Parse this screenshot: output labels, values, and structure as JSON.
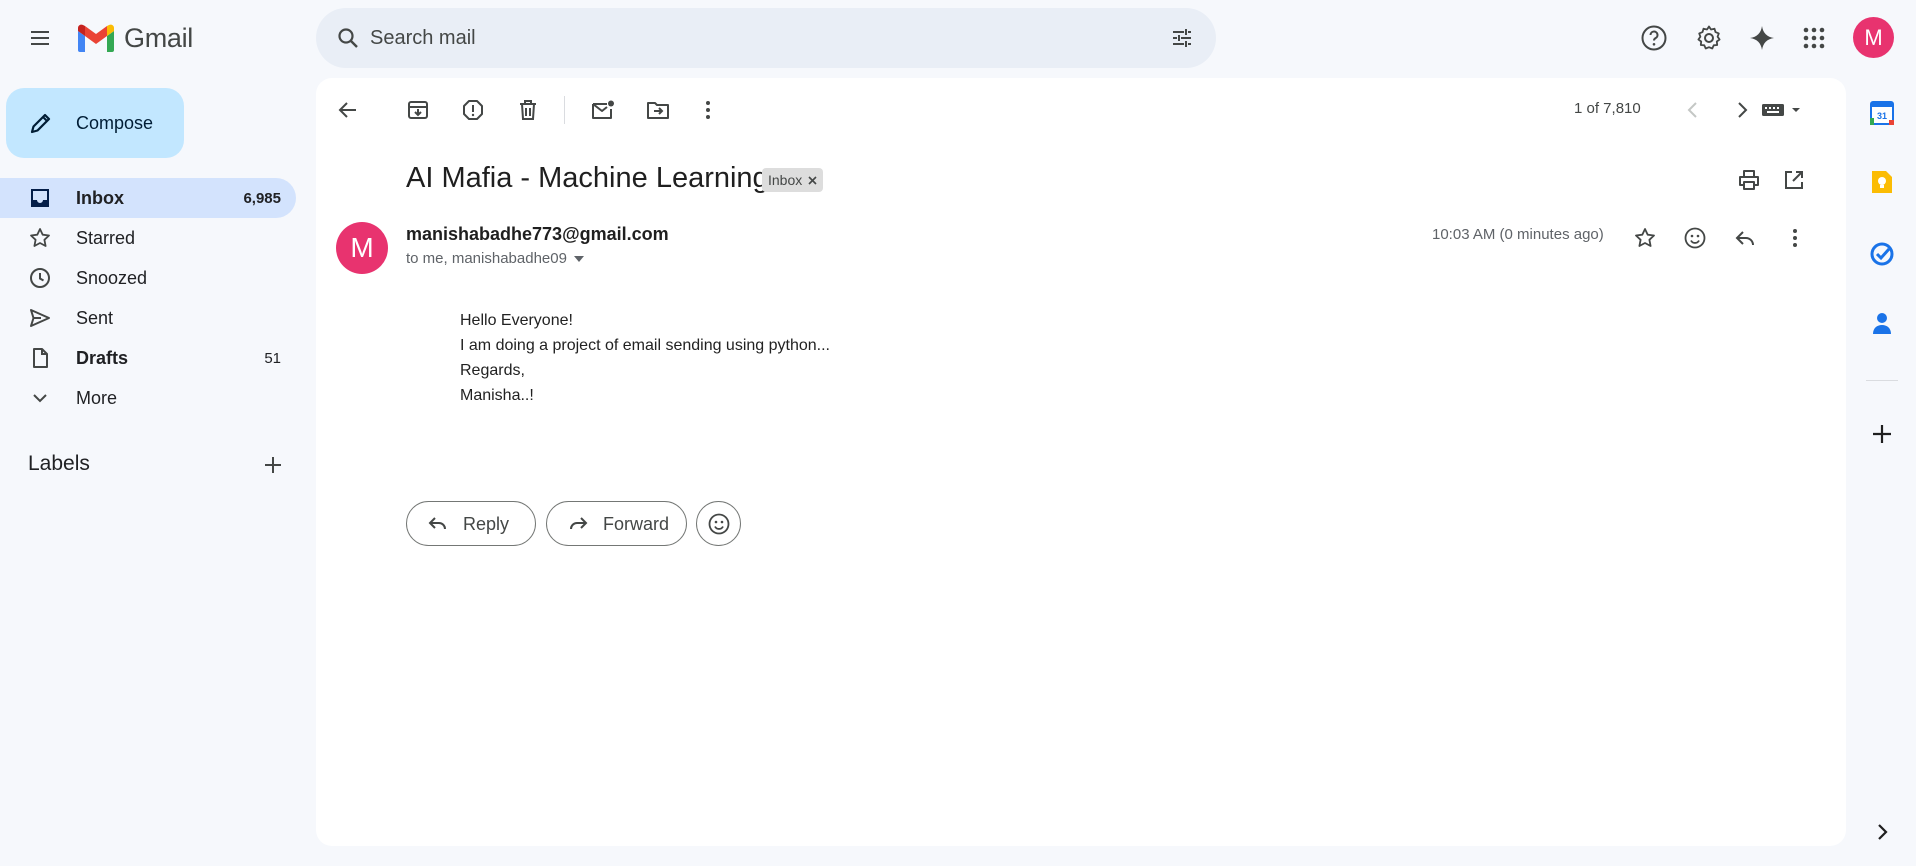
{
  "app": {
    "name": "Gmail"
  },
  "search": {
    "placeholder": "Search mail"
  },
  "account": {
    "avatar_letter": "M",
    "avatar_color": "#e8336f"
  },
  "compose": {
    "label": "Compose"
  },
  "nav": {
    "items": [
      {
        "label": "Inbox",
        "count": "6,985",
        "icon": "inbox-icon",
        "active": true
      },
      {
        "label": "Starred",
        "count": "",
        "icon": "star-icon"
      },
      {
        "label": "Snoozed",
        "count": "",
        "icon": "clock-icon"
      },
      {
        "label": "Sent",
        "count": "",
        "icon": "send-icon"
      },
      {
        "label": "Drafts",
        "count": "51",
        "icon": "draft-icon"
      },
      {
        "label": "More",
        "count": "",
        "icon": "chevron-down-icon"
      }
    ],
    "labels_heading": "Labels"
  },
  "toolbar": {
    "pager": "1 of 7,810"
  },
  "email": {
    "subject": "AI Mafia - Machine Learning",
    "label_chip": "Inbox",
    "sender": "manishabadhe773@gmail.com",
    "recipients": "to me, manishabadhe09",
    "time": "10:03 AM (0 minutes ago)",
    "avatar_letter": "M",
    "body": [
      "Hello Everyone!",
      "I am doing a project of email sending using python...",
      "Regards,",
      "Manisha..!"
    ]
  },
  "actions": {
    "reply": "Reply",
    "forward": "Forward"
  },
  "colors": {
    "accent": "#c2e7ff",
    "active_nav": "#d3e3fd",
    "avatar": "#e8336f"
  }
}
